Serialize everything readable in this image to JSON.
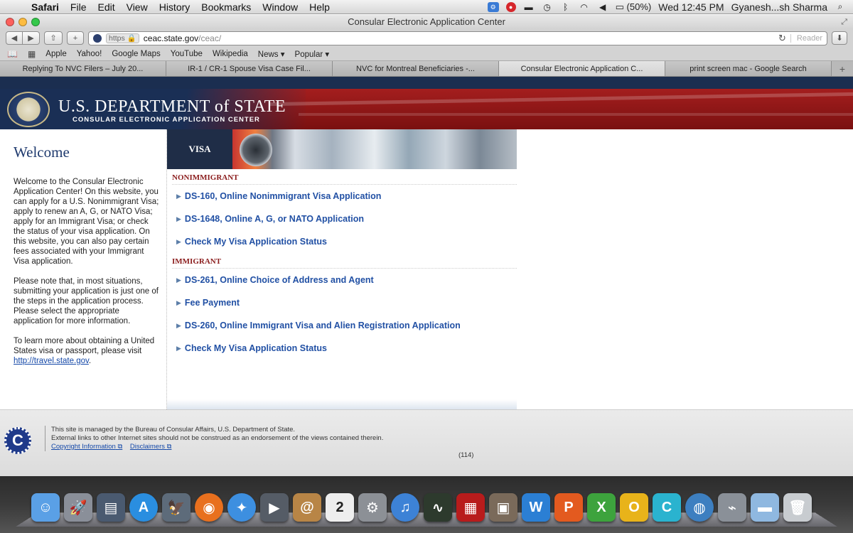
{
  "menubar": {
    "apple": "",
    "items": [
      "Safari",
      "File",
      "Edit",
      "View",
      "History",
      "Bookmarks",
      "Window",
      "Help"
    ],
    "battery": "(50%)",
    "clock": "Wed 12:45 PM",
    "user": "Gyanesh...sh Sharma"
  },
  "window": {
    "title": "Consular Electronic Application Center"
  },
  "toolbar": {
    "https_label": "https",
    "url_host": "ceac.state.gov",
    "url_path": "/ceac/",
    "reader_label": "Reader"
  },
  "bookmarks": [
    "Apple",
    "Yahoo!",
    "Google Maps",
    "YouTube",
    "Wikipedia",
    "News ▾",
    "Popular ▾"
  ],
  "tabs": [
    {
      "label": "Replying To NVC Filers – July 20..."
    },
    {
      "label": "IR-1 / CR-1 Spouse Visa Case Fil..."
    },
    {
      "label": "NVC for Montreal Beneficiaries -..."
    },
    {
      "label": "Consular Electronic Application C..."
    },
    {
      "label": "print screen mac - Google Search"
    }
  ],
  "header": {
    "agency_name": "U.S. DEPARTMENT of STATE",
    "agency_sub": "CONSULAR ELECTRONIC APPLICATION CENTER"
  },
  "sidebar": {
    "title": "Welcome",
    "para1": "Welcome to the Consular Electronic Application Center! On this website, you can apply for a U.S. Nonimmigrant Visa; apply to renew an A, G, or NATO Visa; apply for an Immigrant Visa; or check the status of your visa application. On this website, you can also pay certain fees associated with your Immigrant Visa application.",
    "para2": "Please note that, in most situations, submitting your application is just one of the steps in the application process. Please select the appropriate application for more information.",
    "para3_prefix": "To learn more about obtaining a United States visa or passport, please visit ",
    "para3_link": "http://travel.state.gov",
    "para3_suffix": "."
  },
  "main": {
    "visa_label": "VISA",
    "nonimmigrant_label": "NONIMMIGRANT",
    "nonimmigrant_links": [
      "DS-160, Online Nonimmigrant Visa Application",
      "DS-1648, Online A, G, or NATO Application",
      "Check My Visa Application Status"
    ],
    "immigrant_label": "IMMIGRANT",
    "immigrant_links": [
      "DS-261, Online Choice of Address and Agent",
      "Fee Payment",
      "DS-260, Online Immigrant Visa and Alien Registration Application",
      "Check My Visa Application Status"
    ]
  },
  "footer": {
    "logo_letter": "C",
    "line1": "This site is managed by the Bureau of Consular Affairs, U.S. Department of State.",
    "line2": "External links to other Internet sites should not be construed as an endorsement of the views contained therein.",
    "copyright_link": "Copyright Information",
    "disclaimers_link": "Disclaimers",
    "count": "(114)"
  },
  "dock": {
    "icons": [
      {
        "name": "finder-icon",
        "color": "#5aa0e6"
      },
      {
        "name": "launchpad-icon",
        "color": "#8a8f99"
      },
      {
        "name": "mission-control-icon",
        "color": "#4a5a70"
      },
      {
        "name": "app-store-icon",
        "color": "#2a8ee0"
      },
      {
        "name": "preview-icon",
        "color": "#5d6b7a"
      },
      {
        "name": "firefox-icon",
        "color": "#e8701e"
      },
      {
        "name": "safari-icon",
        "color": "#3d8fe0"
      },
      {
        "name": "facetime-icon",
        "color": "#555c66"
      },
      {
        "name": "address-book-icon",
        "color": "#b88546"
      },
      {
        "name": "calendar-icon",
        "color": "#eeeeee"
      },
      {
        "name": "system-preferences-icon",
        "color": "#8c9096"
      },
      {
        "name": "itunes-icon",
        "color": "#3d82d6"
      },
      {
        "name": "activity-monitor-icon",
        "color": "#2d3a2d"
      },
      {
        "name": "photo-booth-icon",
        "color": "#b81c1c"
      },
      {
        "name": "iphoto-icon",
        "color": "#7a6a5a"
      },
      {
        "name": "word-icon",
        "color": "#2b7fd4"
      },
      {
        "name": "powerpoint-icon",
        "color": "#e35a1f"
      },
      {
        "name": "excel-icon",
        "color": "#3da33d"
      },
      {
        "name": "outlook-icon",
        "color": "#e8b31a"
      },
      {
        "name": "communicator-icon",
        "color": "#2ab3cf"
      },
      {
        "name": "network-icon",
        "color": "#3d7fc0"
      },
      {
        "name": "satellite-icon",
        "color": "#8a9098"
      },
      {
        "name": "folder-icon",
        "color": "#8fb8e0"
      },
      {
        "name": "trash-icon",
        "color": "#c8ccd0"
      }
    ]
  }
}
